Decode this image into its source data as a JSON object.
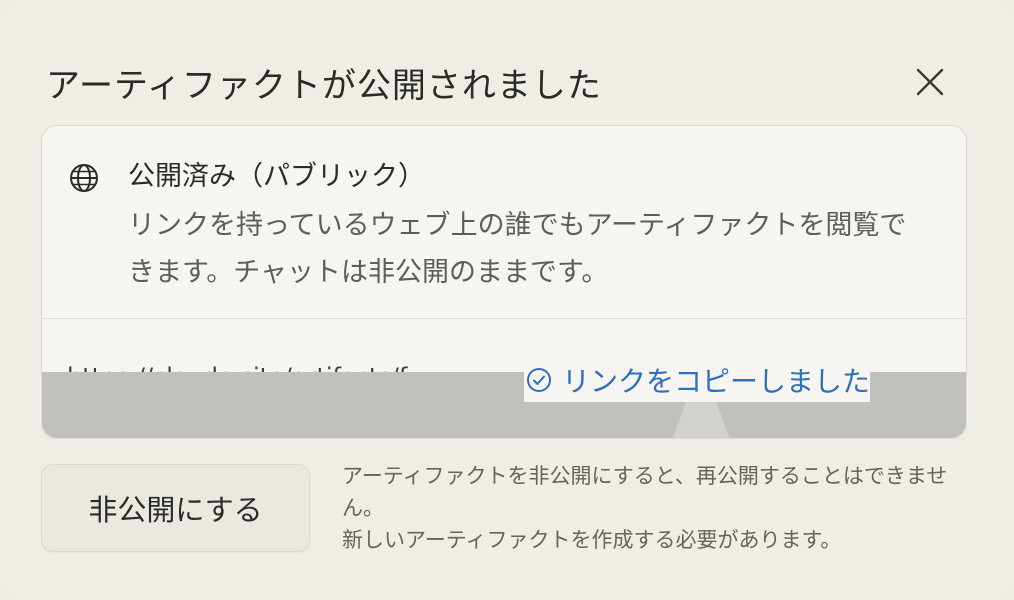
{
  "dialog": {
    "title": "アーティファクトが公開されました",
    "close_icon": "close-icon"
  },
  "status": {
    "icon": "globe-icon",
    "title": "公開済み（パブリック）",
    "description": "リンクを持っているウェブ上の誰でもアーティファクトを閲覧できます。チャットは非公開のままです。"
  },
  "share": {
    "url": "https://claude.site/artifacts/f...",
    "copied_icon": "check-circle-icon",
    "copied_label": "リンクをコピーしました"
  },
  "actions": {
    "unpublish_label": "非公開にする",
    "warning_line1": "アーティファクトを非公開にすると、再公開することはできません。",
    "warning_line2": "新しいアーティファクトを作成する必要があります。"
  },
  "colors": {
    "background": "#f0ede7",
    "accent_link": "#2c6fbf",
    "overlay": "#c0c1bd"
  }
}
